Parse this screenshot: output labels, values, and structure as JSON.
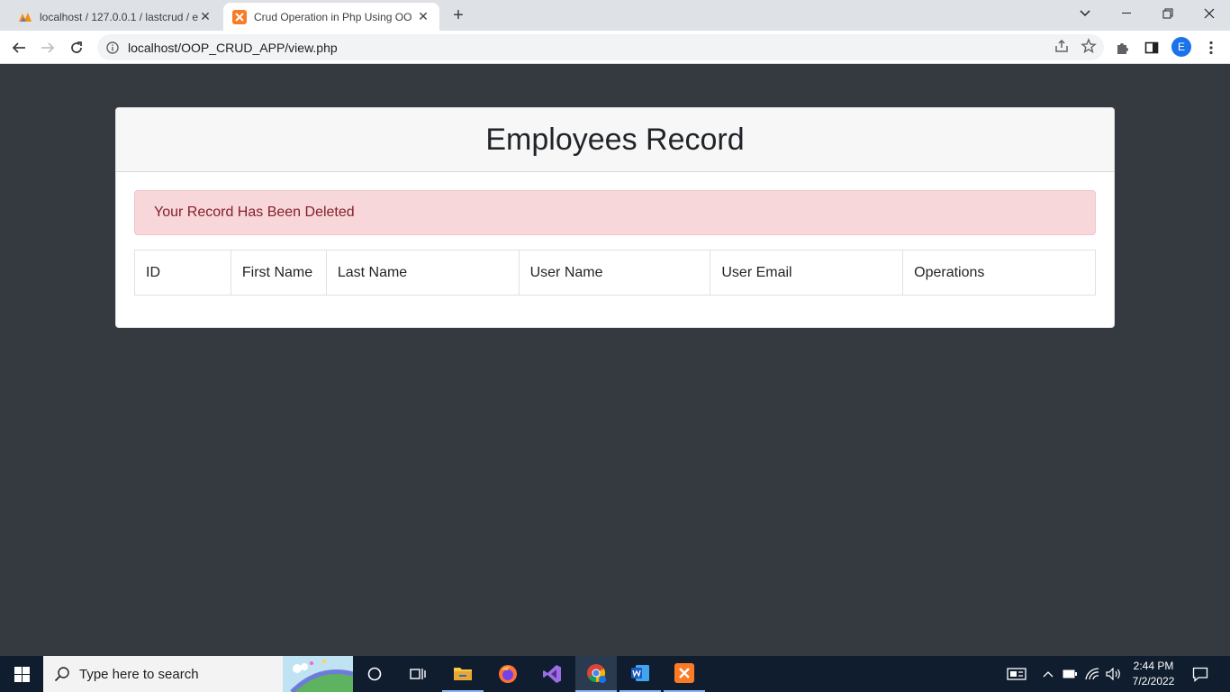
{
  "browser": {
    "tabs": [
      {
        "title": "localhost / 127.0.0.1 / lastcrud / e",
        "active": false
      },
      {
        "title": "Crud Operation in Php Using OO",
        "active": true
      }
    ],
    "address": "localhost/OOP_CRUD_APP/view.php",
    "profile_initial": "E"
  },
  "page": {
    "heading": "Employees Record",
    "alert": "Your Record Has Been Deleted",
    "table_headers": [
      "ID",
      "First Name",
      "Last Name",
      "User Name",
      "User Email",
      "Operations"
    ],
    "rows": []
  },
  "taskbar": {
    "search_placeholder": "Type here to search",
    "time": "2:44 PM",
    "date": "7/2/2022"
  },
  "colors": {
    "page_bg": "#343a40",
    "alert_bg": "#f8d7da",
    "alert_text": "#842029",
    "taskbar_bg": "#0f1d2e",
    "chrome_accent": "#1a73e8"
  }
}
